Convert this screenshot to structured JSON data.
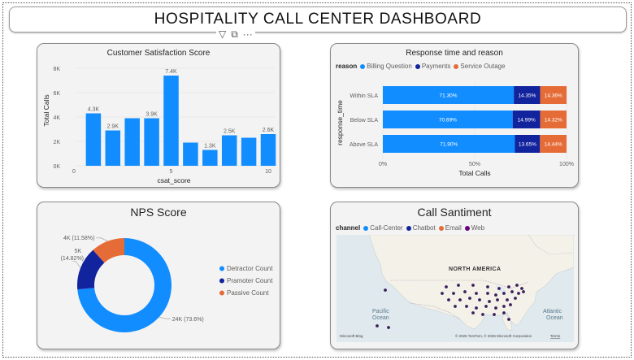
{
  "dashboard": {
    "title": "HOSPITALITY CALL CENTER DASHBOARD",
    "toolbar": {
      "filter_icon": "▽",
      "focus_icon": "⧉",
      "more_icon": "···"
    }
  },
  "csat": {
    "title": "Customer Satisfaction Score",
    "chart_data": {
      "type": "bar",
      "x": [
        1,
        2,
        3,
        4,
        5,
        6,
        7,
        8,
        9,
        10
      ],
      "values": [
        4300,
        2900,
        3900,
        3900,
        7400,
        1900,
        1300,
        2500,
        2300,
        2600
      ],
      "data_labels": [
        "4.3K",
        "2.9K",
        "",
        "3.9K",
        "7.4K",
        "",
        "1.3K",
        "2.5K",
        "",
        "2.6K"
      ],
      "ylim": [
        0,
        8000
      ],
      "yticks": [
        "0K",
        "2K",
        "4K",
        "6K",
        "8K"
      ],
      "xticks": [
        "0",
        "5",
        "10"
      ],
      "xlabel": "csat_score",
      "ylabel": "Total Calls",
      "color": "#118dff"
    }
  },
  "response": {
    "title": "Response time and reason",
    "chart_data": {
      "type": "bar",
      "orientation": "horizontal-100%-stacked",
      "legend_title": "reason",
      "categories": [
        "Within SLA",
        "Below SLA",
        "Above SLA"
      ],
      "series": [
        {
          "name": "Billing Question",
          "color": "#118dff",
          "values": [
            71.3,
            70.69,
            71.9
          ],
          "labels": [
            "71.30%",
            "70.69%",
            "71.90%"
          ]
        },
        {
          "name": "Payments",
          "color": "#12239e",
          "values": [
            14.35,
            14.99,
            13.65
          ],
          "labels": [
            "14.35%",
            "14.99%",
            "13.65%"
          ]
        },
        {
          "name": "Service Outage",
          "color": "#e66c37",
          "values": [
            14.36,
            14.32,
            14.44
          ],
          "labels": [
            "14.36%",
            "14.32%",
            "14.44%"
          ]
        }
      ],
      "xticks": [
        "0%",
        "50%",
        "100%"
      ],
      "xlabel": "Total Calls",
      "ylabel": "response_time"
    }
  },
  "nps": {
    "title": "NPS Score",
    "chart_data": {
      "type": "pie",
      "variant": "donut",
      "slices": [
        {
          "name": "Detractor Count",
          "value": 73.6,
          "label": "24K (73.6%)",
          "color": "#118dff"
        },
        {
          "name": "Pramoter Count",
          "value": 14.82,
          "label1": "5K",
          "label2": "(14.82%)",
          "color": "#12239e"
        },
        {
          "name": "Passive Count",
          "value": 11.58,
          "label": "4K (11.58%)",
          "color": "#e66c37"
        }
      ]
    }
  },
  "sentiment": {
    "title": "Call Santiment",
    "legend_title": "channel",
    "legend": [
      {
        "name": "Call-Center",
        "color": "#118dff"
      },
      {
        "name": "Chatbot",
        "color": "#12239e"
      },
      {
        "name": "Email",
        "color": "#e66c37"
      },
      {
        "name": "Web",
        "color": "#6b007b"
      }
    ],
    "map": {
      "continent_label": "NORTH AMERICA",
      "ocean_left": "Pacific Ocean",
      "ocean_left_1": "Pacific",
      "ocean_left_2": "Ocean",
      "ocean_right_1": "Atlantic",
      "ocean_right_2": "Ocean",
      "attribution": "© 2025 TomTom, © 2025 Microsoft Corporation",
      "terms": "Terms",
      "brand": "Microsoft Bing",
      "point_color": "#3b1f5c"
    }
  }
}
